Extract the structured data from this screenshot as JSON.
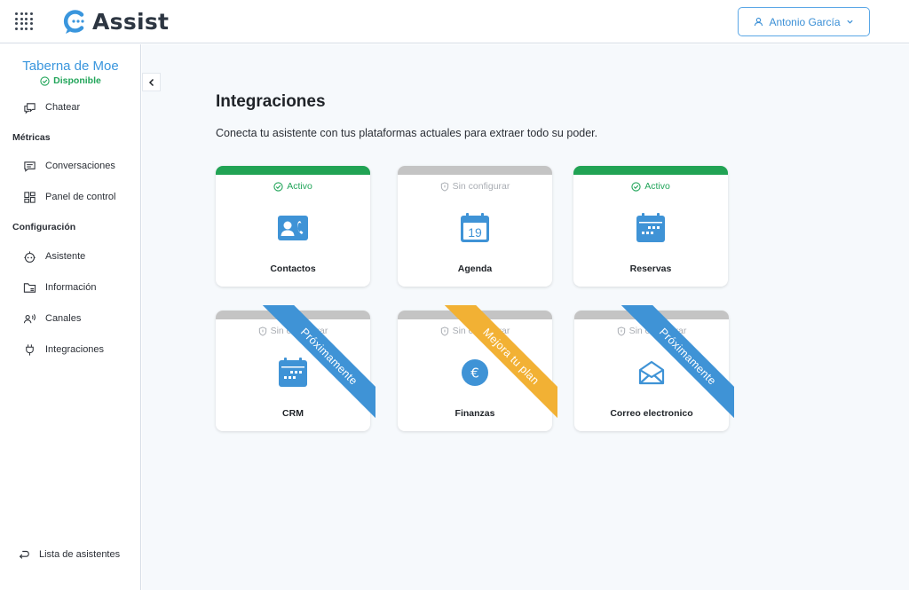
{
  "app": {
    "logo_text": "Assist"
  },
  "user": {
    "name": "Antonio García"
  },
  "sidebar": {
    "org_name": "Taberna de Moe",
    "status": "Disponible",
    "chat": "Chatear",
    "metrics_heading": "Métricas",
    "conversations": "Conversaciones",
    "dashboard": "Panel de control",
    "config_heading": "Configuración",
    "assistant": "Asistente",
    "information": "Información",
    "channels": "Canales",
    "integrations": "Integraciones",
    "assistants_list": "Lista de asistentes"
  },
  "main": {
    "title": "Integraciones",
    "subtitle": "Conecta tu asistente con tus plataformas actuales para extraer todo su poder."
  },
  "cards": [
    {
      "label": "Contactos",
      "status": "Activo",
      "state": "active",
      "icon": "contacts-icon"
    },
    {
      "label": "Agenda",
      "status": "Sin configurar",
      "state": "unconfigured",
      "icon": "calendar-19-icon",
      "icon_text": "19"
    },
    {
      "label": "Reservas",
      "status": "Activo",
      "state": "active",
      "icon": "reservations-calendar-icon"
    },
    {
      "label": "CRM",
      "status": "Sin configurar",
      "state": "unconfigured",
      "icon": "crm-calendar-icon",
      "ribbon": "Próximamente",
      "ribbon_color": "#3f93d6"
    },
    {
      "label": "Finanzas",
      "status": "Sin configurar",
      "state": "unconfigured",
      "icon": "euro-icon",
      "icon_text": "€",
      "ribbon": "Mejora tu plan",
      "ribbon_color": "#f2b134"
    },
    {
      "label": "Correo electronico",
      "status": "Sin configurar",
      "state": "unconfigured",
      "icon": "envelope-icon",
      "ribbon": "Próximamente",
      "ribbon_color": "#3f93d6"
    }
  ],
  "colors": {
    "accent": "#3a96dd",
    "active": "#21a354",
    "unconfigured": "#c4c4c4",
    "upgrade": "#f2b134"
  }
}
